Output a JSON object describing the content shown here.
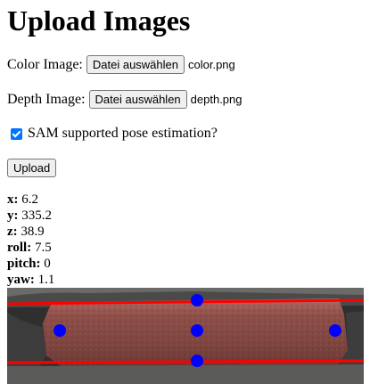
{
  "page": {
    "title": "Upload Images"
  },
  "color_image": {
    "label": "Color Image:",
    "button": "Datei auswählen",
    "file": "color.png"
  },
  "depth_image": {
    "label": "Depth Image:",
    "button": "Datei auswählen",
    "file": "depth.png"
  },
  "sam_option": {
    "label": "SAM supported pose estimation?",
    "checked": true
  },
  "upload": {
    "label": "Upload"
  },
  "pose": [
    {
      "key": "x:",
      "value": "6.2"
    },
    {
      "key": "y:",
      "value": "335.2"
    },
    {
      "key": "z:",
      "value": "38.9"
    },
    {
      "key": "roll:",
      "value": "7.5"
    },
    {
      "key": "pitch:",
      "value": "0"
    },
    {
      "key": "yaw:",
      "value": "1.1"
    }
  ],
  "colors": {
    "line": "#ff0000",
    "keypoint": "#0000ff",
    "brick": "#8a4a44",
    "background": "#3a3a3a"
  },
  "icons": {
    "checkbox": "checkbox-checked-icon"
  }
}
